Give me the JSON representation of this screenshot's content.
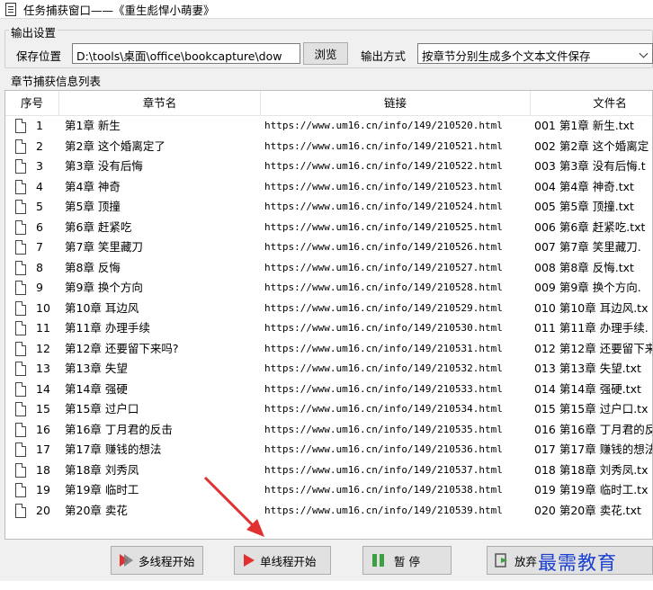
{
  "window": {
    "title": "任务捕获窗口——《重生彪悍小萌妻》"
  },
  "output_settings": {
    "group_label": "输出设置",
    "save_location_label": "保存位置",
    "save_path": "D:\\tools\\桌面\\office\\bookcapture\\dow",
    "browse_label": "浏览",
    "output_mode_label": "输出方式",
    "output_mode_value": "按章节分别生成多个文本文件保存"
  },
  "chapter_list": {
    "group_label": "章节捕获信息列表",
    "columns": [
      "序号",
      "章节名",
      "链接",
      "文件名"
    ],
    "rows": [
      {
        "no": "1",
        "name": "第1章 新生",
        "url": "https://www.um16.cn/info/149/210520.html",
        "file": "001 第1章 新生.txt"
      },
      {
        "no": "2",
        "name": "第2章 这个婚离定了",
        "url": "https://www.um16.cn/info/149/210521.html",
        "file": "002 第2章 这个婚离定"
      },
      {
        "no": "3",
        "name": "第3章 没有后悔",
        "url": "https://www.um16.cn/info/149/210522.html",
        "file": "003 第3章 没有后悔.t"
      },
      {
        "no": "4",
        "name": "第4章 神奇",
        "url": "https://www.um16.cn/info/149/210523.html",
        "file": "004 第4章 神奇.txt"
      },
      {
        "no": "5",
        "name": "第5章 顶撞",
        "url": "https://www.um16.cn/info/149/210524.html",
        "file": "005 第5章 顶撞.txt"
      },
      {
        "no": "6",
        "name": "第6章 赶紧吃",
        "url": "https://www.um16.cn/info/149/210525.html",
        "file": "006 第6章 赶紧吃.txt"
      },
      {
        "no": "7",
        "name": "第7章 笑里藏刀",
        "url": "https://www.um16.cn/info/149/210526.html",
        "file": "007 第7章 笑里藏刀."
      },
      {
        "no": "8",
        "name": "第8章 反悔",
        "url": "https://www.um16.cn/info/149/210527.html",
        "file": "008 第8章 反悔.txt"
      },
      {
        "no": "9",
        "name": "第9章 换个方向",
        "url": "https://www.um16.cn/info/149/210528.html",
        "file": "009 第9章 换个方向."
      },
      {
        "no": "10",
        "name": "第10章 耳边风",
        "url": "https://www.um16.cn/info/149/210529.html",
        "file": "010 第10章 耳边风.tx"
      },
      {
        "no": "11",
        "name": "第11章 办理手续",
        "url": "https://www.um16.cn/info/149/210530.html",
        "file": "011 第11章 办理手续."
      },
      {
        "no": "12",
        "name": "第12章 还要留下来吗?",
        "url": "https://www.um16.cn/info/149/210531.html",
        "file": "012 第12章 还要留下来"
      },
      {
        "no": "13",
        "name": "第13章 失望",
        "url": "https://www.um16.cn/info/149/210532.html",
        "file": "013 第13章 失望.txt"
      },
      {
        "no": "14",
        "name": "第14章 强硬",
        "url": "https://www.um16.cn/info/149/210533.html",
        "file": "014 第14章 强硬.txt"
      },
      {
        "no": "15",
        "name": "第15章 过户口",
        "url": "https://www.um16.cn/info/149/210534.html",
        "file": "015 第15章 过户口.tx"
      },
      {
        "no": "16",
        "name": "第16章 丁月君的反击",
        "url": "https://www.um16.cn/info/149/210535.html",
        "file": "016 第16章 丁月君的反"
      },
      {
        "no": "17",
        "name": "第17章 赚钱的想法",
        "url": "https://www.um16.cn/info/149/210536.html",
        "file": "017 第17章 赚钱的想法"
      },
      {
        "no": "18",
        "name": "第18章 刘秀凤",
        "url": "https://www.um16.cn/info/149/210537.html",
        "file": "018 第18章 刘秀凤.tx"
      },
      {
        "no": "19",
        "name": "第19章 临时工",
        "url": "https://www.um16.cn/info/149/210538.html",
        "file": "019 第19章 临时工.tx"
      },
      {
        "no": "20",
        "name": "第20章 卖花",
        "url": "https://www.um16.cn/info/149/210539.html",
        "file": "020 第20章 卖花.txt"
      }
    ]
  },
  "actions": {
    "multi_thread_label": "多线程开始",
    "single_thread_label": "单线程开始",
    "pause_label": "暂 停",
    "abandon_label": "放弃"
  },
  "watermark": "最需教育",
  "colors": {
    "accent_red": "#e03030",
    "watermark_blue": "#1a3fd0",
    "pause_green": "#3aa040"
  }
}
